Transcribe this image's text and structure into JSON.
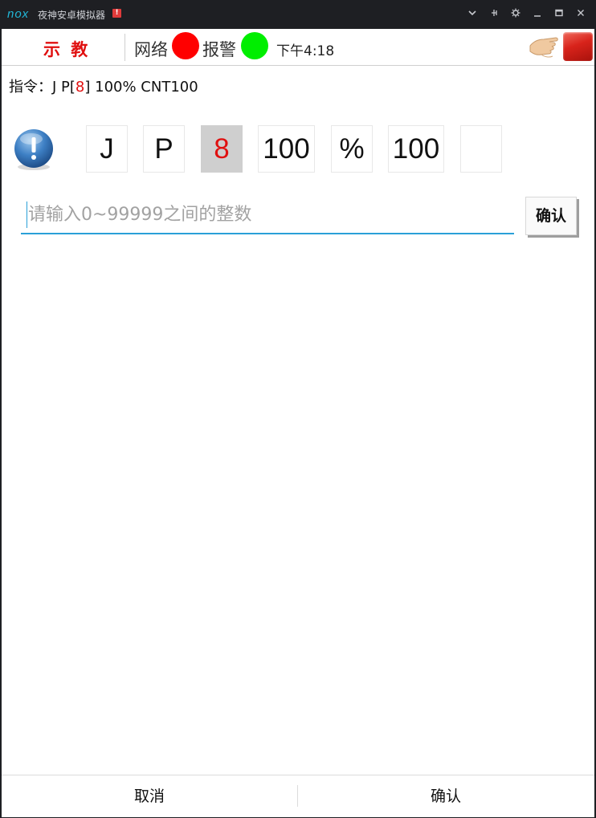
{
  "window": {
    "logo": "nox",
    "title": "夜神安卓模拟器",
    "badge": "!",
    "controls": [
      "chevron-down-icon",
      "pin-icon",
      "gear-icon",
      "minimize-icon",
      "maximize-icon",
      "close-icon"
    ]
  },
  "topbar": {
    "mode": "示 教",
    "network_label": "网络",
    "network_status_color": "#ff0000",
    "alarm_label": "报警",
    "alarm_status_color": "#00ee00",
    "clock": "下午4:18"
  },
  "instruction": {
    "prefix": "指令：J  P[",
    "index": "8",
    "suffix": "] 100% CNT100"
  },
  "tokens": [
    {
      "text": "J",
      "selected": false
    },
    {
      "text": "P",
      "selected": false
    },
    {
      "text": "8",
      "selected": true
    },
    {
      "text": "100",
      "selected": false
    },
    {
      "text": "%",
      "selected": false
    },
    {
      "text": "100",
      "selected": false
    },
    {
      "text": "",
      "selected": false
    }
  ],
  "input": {
    "value": "",
    "placeholder": "请输入0~99999之间的整数",
    "confirm_label": "确认"
  },
  "footer": {
    "cancel_label": "取消",
    "confirm_label": "确认"
  },
  "colors": {
    "accent": "#2aa0d8",
    "highlight": "#e01010"
  }
}
